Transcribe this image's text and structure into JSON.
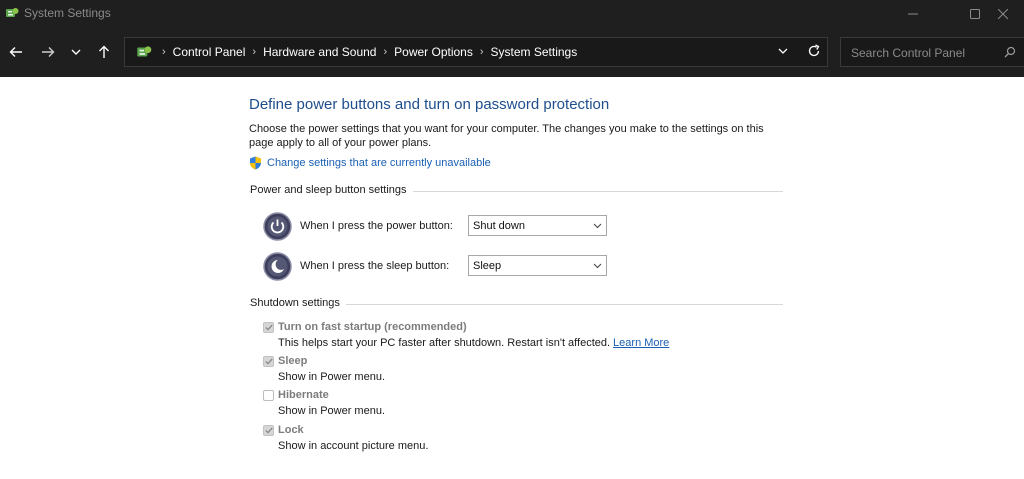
{
  "window": {
    "title": "System Settings",
    "icon": "control-panel-icon",
    "controls": [
      "minimize-icon",
      "maximize-icon",
      "close-icon"
    ]
  },
  "nav": {
    "buttons": [
      "back-arrow-icon",
      "forward-arrow-icon",
      "recent-chevron-icon",
      "up-arrow-icon"
    ],
    "breadcrumbs": [
      "Control Panel",
      "Hardware and Sound",
      "Power Options",
      "System Settings"
    ],
    "search_placeholder": "Search Control Panel"
  },
  "main": {
    "title": "Define power buttons and turn on password protection",
    "description": "Choose the power settings that you want for your computer. The changes you make to the settings on this page apply to all of your power plans.",
    "change_link": "Change settings that are currently unavailable",
    "power_sleep_section": {
      "heading": "Power and sleep button settings",
      "rows": [
        {
          "label": "When I press the power button:",
          "value": "Shut down",
          "icon": "power-button-icon"
        },
        {
          "label": "When I press the sleep button:",
          "value": "Sleep",
          "icon": "sleep-button-icon"
        }
      ]
    },
    "shutdown_section": {
      "heading": "Shutdown settings",
      "options": [
        {
          "label": "Turn on fast startup (recommended)",
          "sub": "This helps start your PC faster after shutdown. Restart isn't affected.",
          "link": "Learn More",
          "checked": true
        },
        {
          "label": "Sleep",
          "sub": "Show in Power menu.",
          "checked": true
        },
        {
          "label": "Hibernate",
          "sub": "Show in Power menu.",
          "checked": false
        },
        {
          "label": "Lock",
          "sub": "Show in account picture menu.",
          "checked": true
        }
      ]
    }
  },
  "colors": {
    "titlebar_bg": "#1f1f1f",
    "heading_blue": "#1e4e8c",
    "link_blue": "#1a5fb4",
    "disabled_text": "#7c7c7c"
  }
}
